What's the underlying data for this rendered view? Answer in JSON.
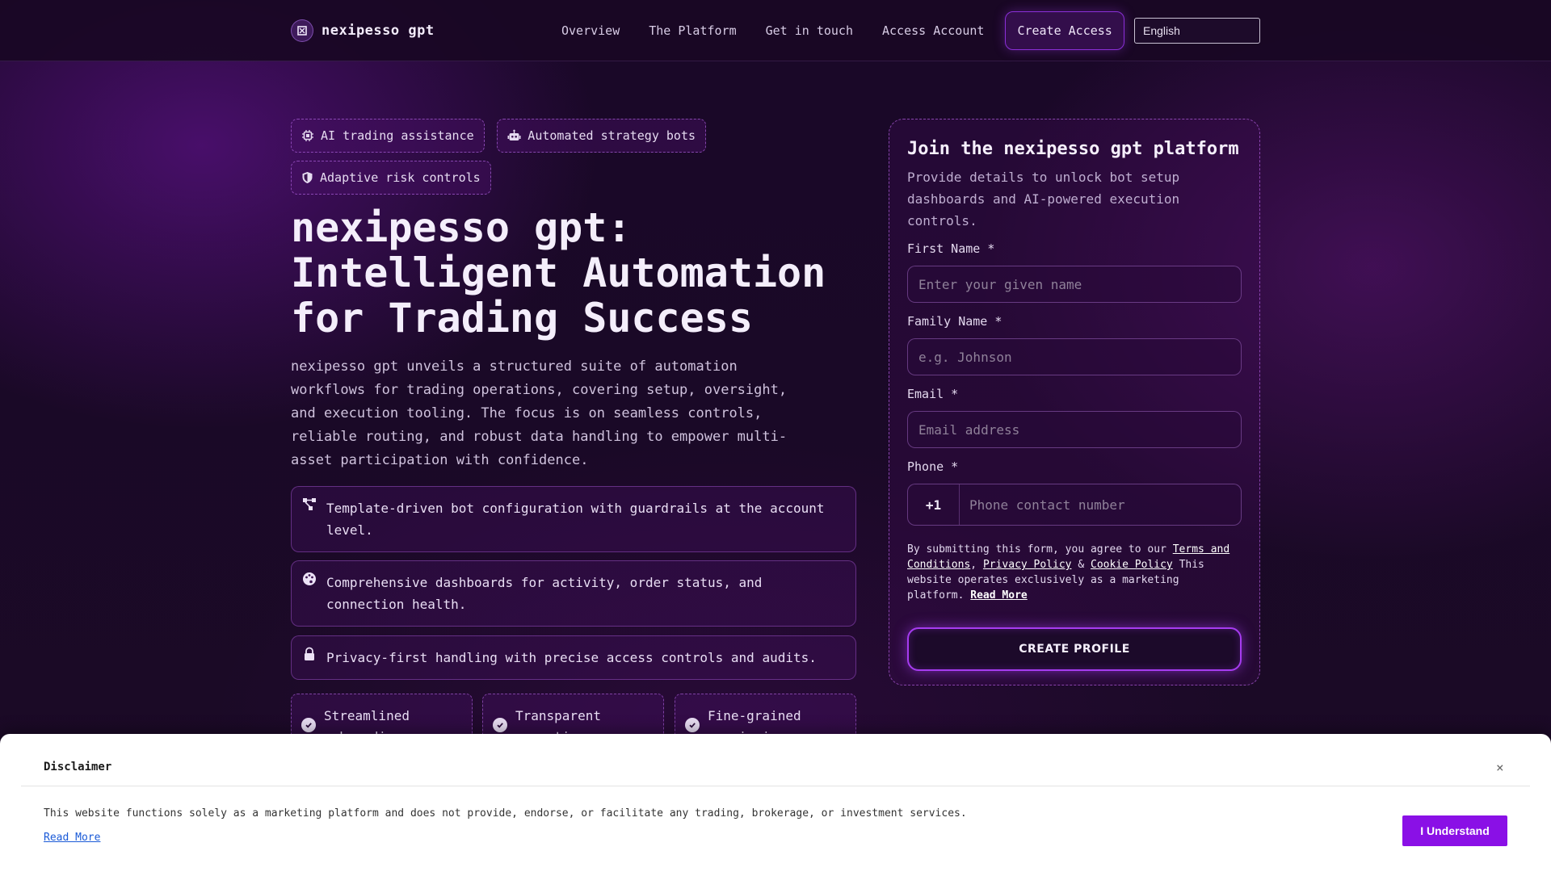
{
  "header": {
    "brand_name": "nexipesso gpt",
    "nav": [
      "Overview",
      "The Platform",
      "Get in touch",
      "Access Account"
    ],
    "cta_label": "Create Access",
    "language": "English"
  },
  "hero": {
    "badges": [
      "AI trading assistance",
      "Automated strategy bots",
      "Adaptive risk controls"
    ],
    "title_line1": "nexipesso gpt:",
    "title_line2": "Intelligent Automation",
    "title_line3": "for Trading Success",
    "description": "nexipesso gpt unveils a structured suite of automation workflows for trading operations, covering setup, oversight, and execution tooling. The focus is on seamless controls, reliable routing, and robust data handling to empower multi-asset participation with confidence.",
    "features": [
      "Template-driven bot configuration with guardrails at the account level.",
      "Comprehensive dashboards for activity, order status, and connection health.",
      "Privacy-first handling with precise access controls and audits."
    ],
    "highlights": [
      "Streamlined onboarding",
      "Transparent reporting",
      "Fine-grained permissions"
    ]
  },
  "form": {
    "title": "Join the nexipesso gpt platform",
    "subtitle": "Provide details to unlock bot setup dashboards and AI-powered execution controls.",
    "first_name_label": "First Name *",
    "first_name_placeholder": "Enter your given name",
    "family_name_label": "Family Name *",
    "family_name_placeholder": "e.g. Johnson",
    "email_label": "Email *",
    "email_placeholder": "Email address",
    "phone_label": "Phone *",
    "phone_code": "+1",
    "phone_placeholder": "Phone contact number",
    "consent_prefix": "By submitting this form, you agree to our",
    "terms_link": "Terms and Conditions",
    "comma": ",",
    "privacy_link": "Privacy Policy",
    "amp": "&",
    "cookie_link": "Cookie Policy",
    "consent_suffix": "This website operates exclusively as a marketing platform.",
    "read_more": "Read More",
    "submit_label": "CREATE PROFILE"
  },
  "disclaimer": {
    "title": "Disclaimer",
    "close": "×",
    "text": "This website functions solely as a marketing platform and does not provide, endorse, or facilitate any trading, brokerage, or investment services.",
    "read_more": "Read More",
    "button": "I Understand"
  },
  "colors": {
    "accent": "#a855f7",
    "button_purple": "#8a10e6",
    "background": "#1a0828"
  }
}
